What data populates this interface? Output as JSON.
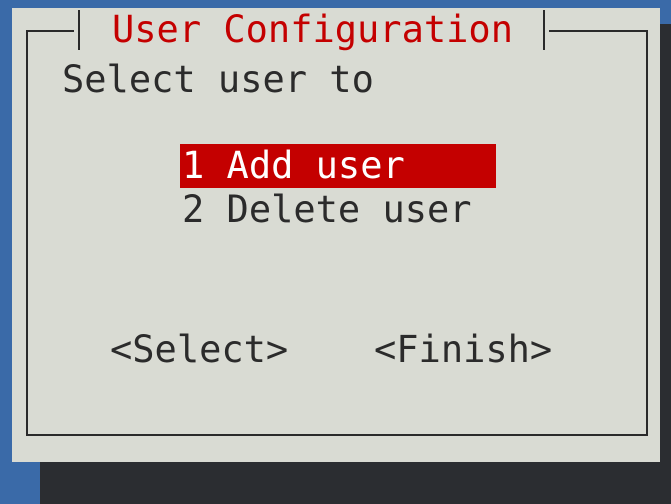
{
  "dialog": {
    "title": "User Configuration",
    "prompt": "Select user to"
  },
  "menu": {
    "items": [
      {
        "label": "1 Add user",
        "selected": true
      },
      {
        "label": "2 Delete user",
        "selected": false
      }
    ]
  },
  "buttons": {
    "select": "<Select>",
    "finish": "<Finish>"
  },
  "colors": {
    "background": "#3a6aa8",
    "dialog": "#d9dbd3",
    "accent": "#c40000",
    "text": "#2b2b2b"
  }
}
